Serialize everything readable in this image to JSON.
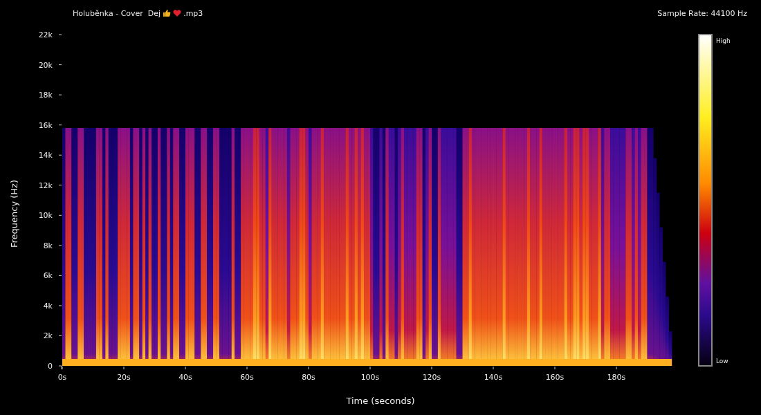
{
  "title": {
    "text_before": "Holuběnka - Cover  Dej",
    "text_after": ".mp3"
  },
  "sample_rate": "Sample Rate: 44100 Hz",
  "y_axis": {
    "label": "Frequency (Hz)",
    "ticks": [
      "22k",
      "20k",
      "18k",
      "16k",
      "14k",
      "12k",
      "10k",
      "8k",
      "6k",
      "4k",
      "2k",
      "0"
    ]
  },
  "x_axis": {
    "label": "Time (seconds)",
    "ticks": [
      "0s",
      "20s",
      "40s",
      "60s",
      "80s",
      "100s",
      "120s",
      "140s",
      "160s",
      "180s"
    ]
  },
  "color_scale": {
    "high": "High",
    "low": "Low"
  }
}
